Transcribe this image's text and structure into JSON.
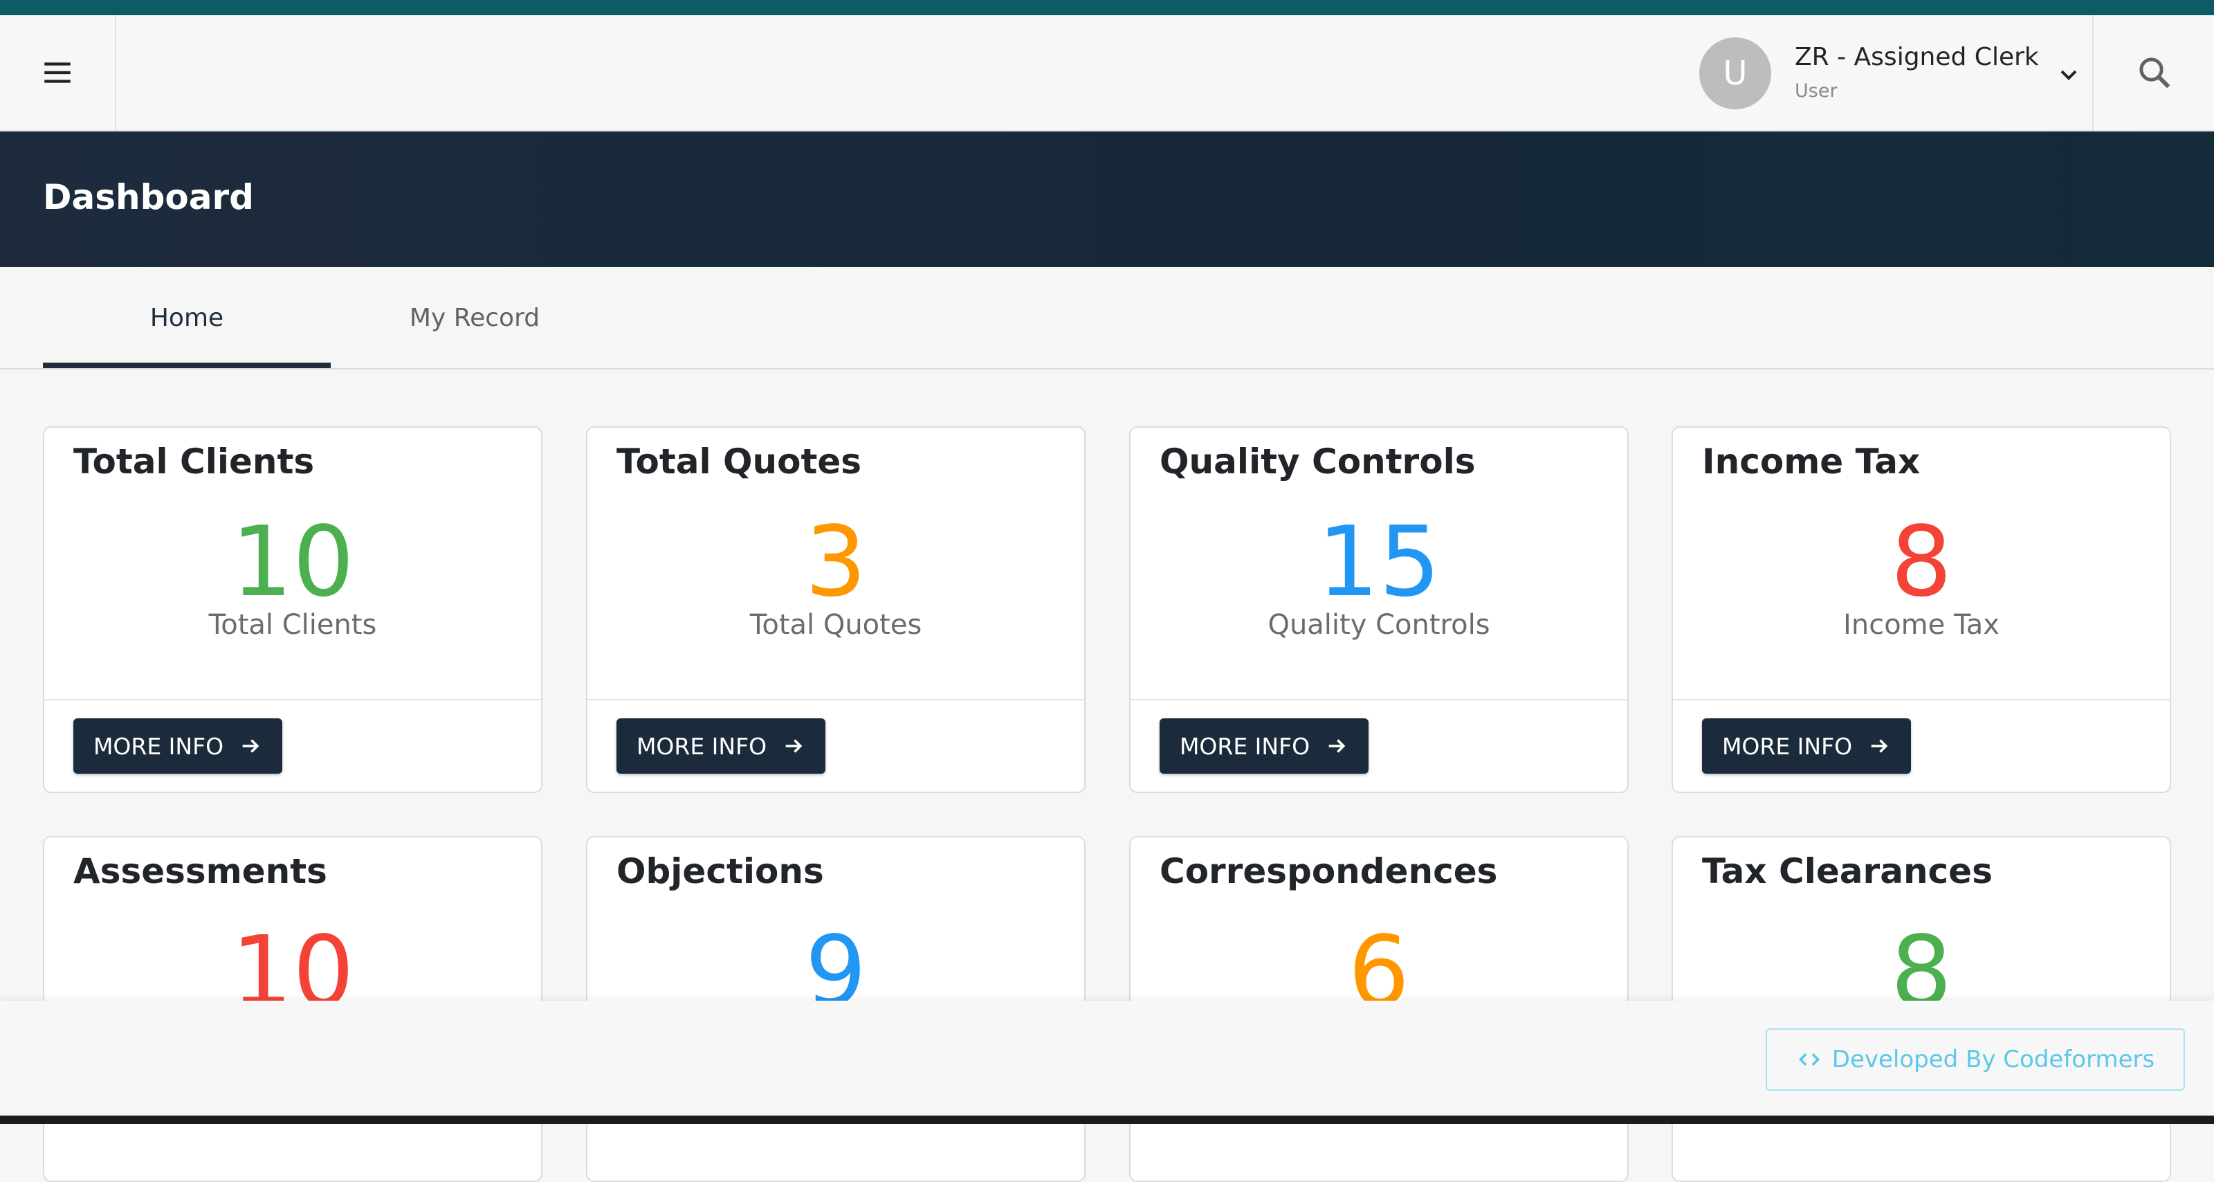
{
  "header": {
    "avatar_letter": "U",
    "user_name": "ZR - Assigned Clerk",
    "user_role": "User",
    "icons": {
      "menu": "menu-icon",
      "chevron": "chevron-down-icon",
      "search": "search-icon"
    }
  },
  "banner": {
    "title": "Dashboard"
  },
  "tabs": [
    {
      "label": "Home",
      "active": true
    },
    {
      "label": "My Record",
      "active": false
    }
  ],
  "cards": [
    {
      "title": "Total Clients",
      "value": "10",
      "subtitle": "Total Clients",
      "color": "#4caf50",
      "button": "MORE INFO"
    },
    {
      "title": "Total Quotes",
      "value": "3",
      "subtitle": "Total Quotes",
      "color": "#ff9800",
      "button": "MORE INFO"
    },
    {
      "title": "Quality Controls",
      "value": "15",
      "subtitle": "Quality Controls",
      "color": "#2196f3",
      "button": "MORE INFO"
    },
    {
      "title": "Income Tax",
      "value": "8",
      "subtitle": "Income Tax",
      "color": "#f44336",
      "button": "MORE INFO"
    },
    {
      "title": "Assessments",
      "value": "10",
      "color": "#f44336"
    },
    {
      "title": "Objections",
      "value": "9",
      "color": "#2196f3"
    },
    {
      "title": "Correspondences",
      "value": "6",
      "color": "#ff9800"
    },
    {
      "title": "Tax Clearances",
      "value": "8",
      "color": "#4caf50"
    }
  ],
  "footer": {
    "badge_label": "Developed By Codeformers",
    "badge_icon": "code-icon"
  },
  "colors": {
    "accent_dark": "#1c2b3b",
    "top_strip": "#0d5b63",
    "badge": "#5bc8e8"
  }
}
